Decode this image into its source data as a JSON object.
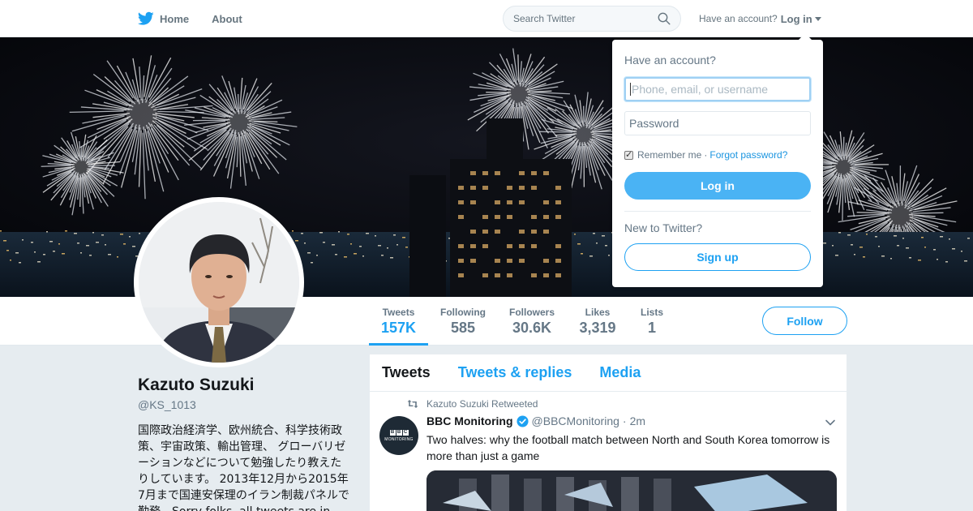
{
  "nav": {
    "home": "Home",
    "about": "About",
    "search_placeholder": "Search Twitter",
    "have_account": "Have an account?",
    "login": "Log in"
  },
  "profile": {
    "name": "Kazuto Suzuki",
    "handle": "@KS_1013",
    "bio": "国際政治経済学、欧州統合、科学技術政策、宇宙政策、輸出管理、 グローバリゼーションなどについて勉強したり教えたりしています。 2013年12月から2015年7月まで国連安保理のイラン制裁パネルで勤務。Sorry folks, all tweets are in"
  },
  "stats": [
    {
      "label": "Tweets",
      "value": "157K"
    },
    {
      "label": "Following",
      "value": "585"
    },
    {
      "label": "Followers",
      "value": "30.6K"
    },
    {
      "label": "Likes",
      "value": "3,319"
    },
    {
      "label": "Lists",
      "value": "1"
    }
  ],
  "follow_label": "Follow",
  "timeline": {
    "tabs": [
      "Tweets",
      "Tweets & replies",
      "Media"
    ],
    "retweet_line": "Kazuto Suzuki Retweeted",
    "tweet": {
      "name": "BBC Monitoring",
      "handle": "@BBCMonitoring",
      "time": "2m",
      "text": "Two halves: why the football match between North and South Korea tomorrow is more than just a game",
      "avatar_mark": [
        "B",
        "B",
        "C"
      ],
      "avatar_sub": "MONITORING"
    }
  },
  "dropdown": {
    "title": "Have an account?",
    "username_placeholder": "Phone, email, or username",
    "password_placeholder": "Password",
    "remember": "Remember me",
    "separator": "·",
    "forgot": "Forgot password?",
    "login_button": "Log in",
    "new_title": "New to Twitter?",
    "signup_button": "Sign up"
  },
  "colors": {
    "accent": "#1da1f2",
    "login_button": "#4ab3f4",
    "background": "#e6ecf0"
  }
}
